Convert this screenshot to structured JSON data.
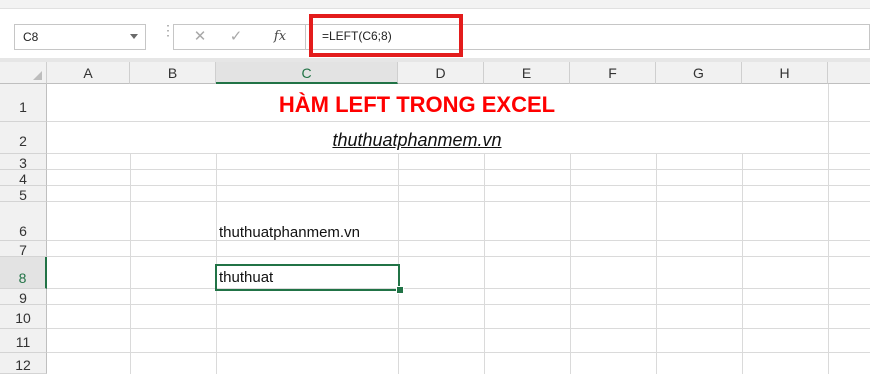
{
  "formula_bar": {
    "name_box": "C8",
    "cancel_icon": "cancel-icon",
    "enter_icon": "enter-icon",
    "fx_label": "fx",
    "formula": "=LEFT(C6;8)"
  },
  "grid": {
    "columns": [
      "A",
      "B",
      "C",
      "D",
      "E",
      "F",
      "G",
      "H"
    ],
    "selected_column": "C",
    "rows": [
      "1",
      "2",
      "3",
      "4",
      "5",
      "6",
      "7",
      "8",
      "9",
      "10",
      "11",
      "12"
    ],
    "selected_row": "8"
  },
  "cells": {
    "title": "HÀM LEFT TRONG EXCEL",
    "subtitle": "thuthuatphanmem.vn",
    "C6": "thuthuatphanmem.vn",
    "C8": "thuthuat"
  },
  "colors": {
    "title": "#ff0000",
    "selection": "#217346",
    "highlight_box": "#e31c1c"
  }
}
